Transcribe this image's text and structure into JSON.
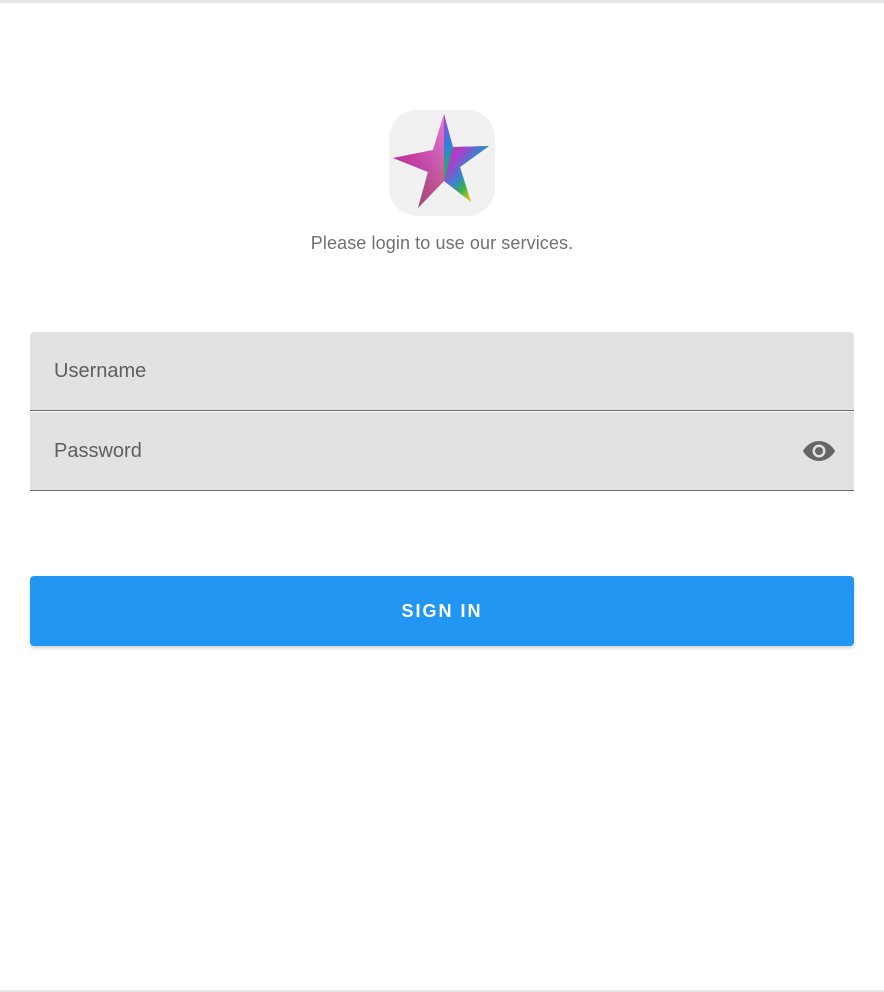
{
  "app": {
    "logo_icon": "rainbow-star-icon",
    "subtitle": "Please login to use our services."
  },
  "form": {
    "username": {
      "placeholder": "Username",
      "value": ""
    },
    "password": {
      "placeholder": "Password",
      "value": "",
      "toggle_icon": "eye-icon"
    },
    "submit_label": "SIGN IN"
  },
  "colors": {
    "accent": "#2196f3",
    "field_background": "#e2e2e2",
    "subtitle_text": "#707070",
    "icon": "#666666"
  }
}
